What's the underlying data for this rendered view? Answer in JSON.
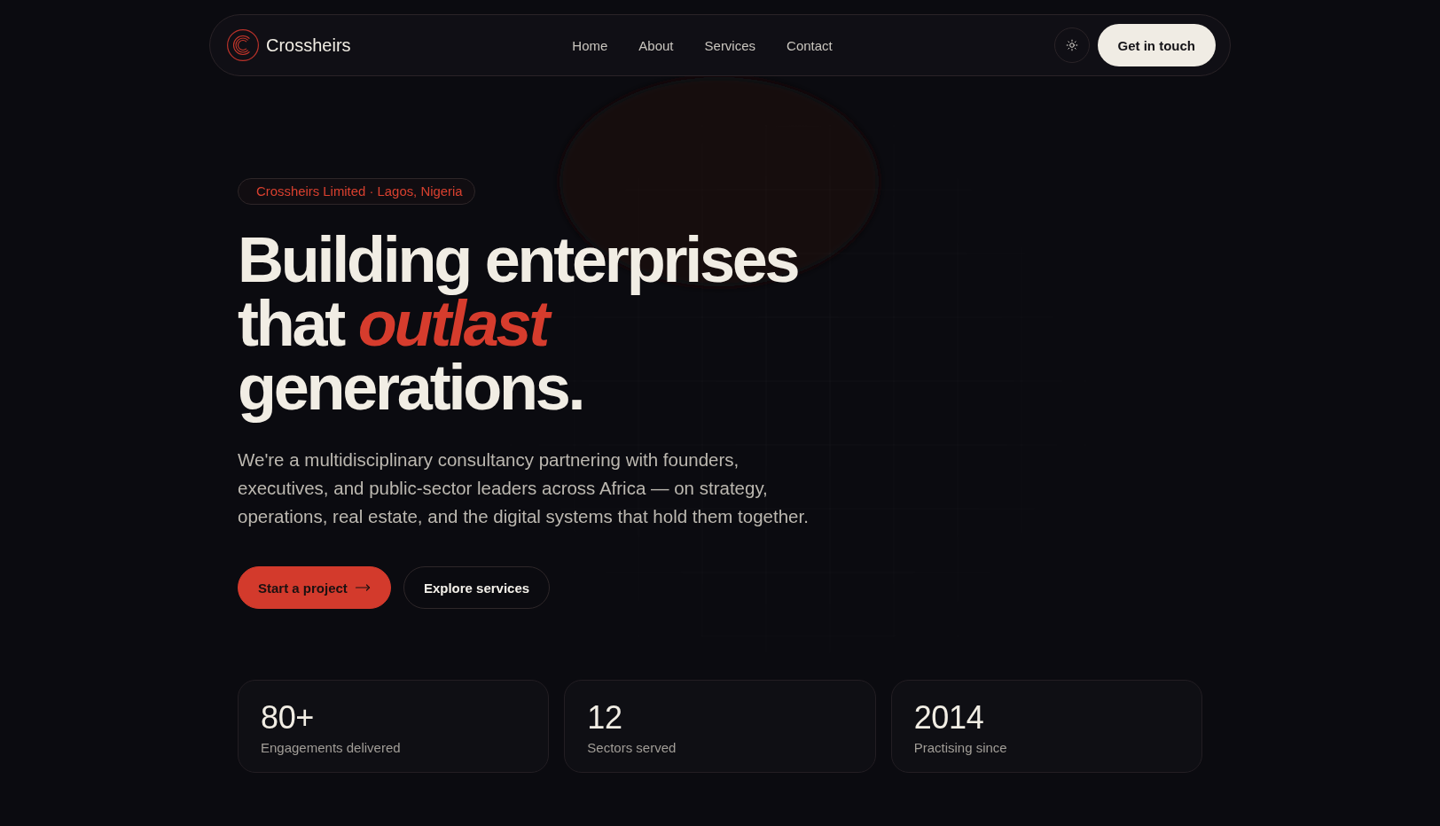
{
  "nav": {
    "brand": "Crossheirs",
    "links": [
      {
        "label": "Home"
      },
      {
        "label": "About"
      },
      {
        "label": "Services"
      },
      {
        "label": "Contact"
      }
    ],
    "cta": "Get in touch"
  },
  "hero": {
    "badge": "Crossheirs Limited · Lagos, Nigeria",
    "headline": "Building enterprises that *outlast* generations.",
    "intro": "We're a multidisciplinary consultancy partnering with founders, executives, and public-sector leaders across Africa — on strategy, operations, real estate, and the digital systems that hold them together.",
    "buttons": [
      {
        "label": "Start a project",
        "kind": "primary"
      },
      {
        "label": "Explore services",
        "kind": "secondary"
      }
    ]
  },
  "stats": [
    {
      "value": "80+",
      "label": "Engagements delivered"
    },
    {
      "value": "12",
      "label": "Sectors served"
    },
    {
      "value": "2014",
      "label": "Practising since"
    }
  ]
}
